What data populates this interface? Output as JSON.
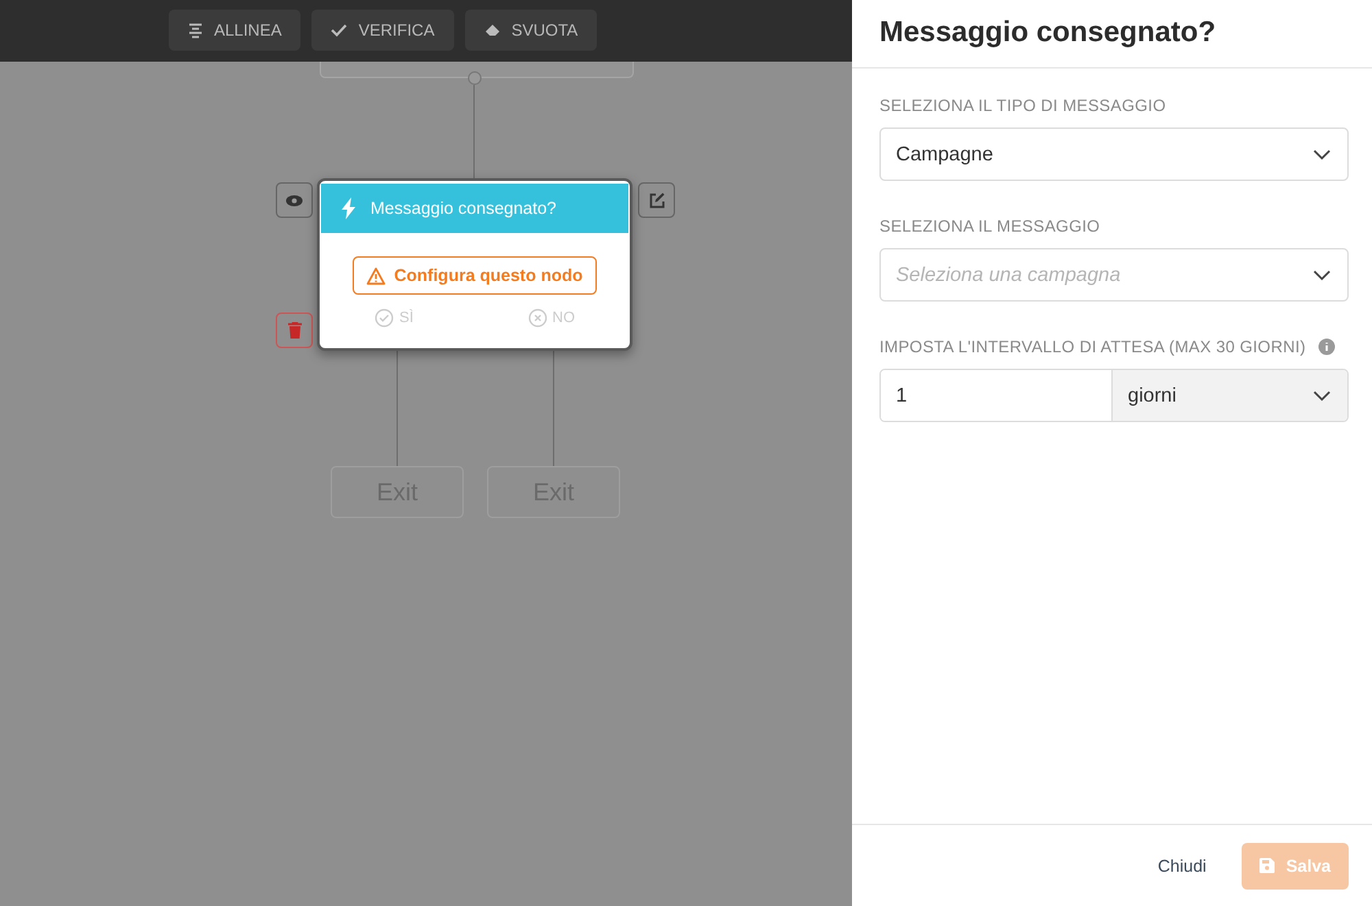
{
  "toolbar": [
    {
      "kind": "align",
      "label": "ALLINEA"
    },
    {
      "kind": "check",
      "label": "VERIFICA"
    },
    {
      "kind": "eraser",
      "label": "SVUOTA"
    }
  ],
  "node": {
    "title": "Messaggio consegnato?",
    "configure": "Configura questo nodo",
    "branches": [
      {
        "kind": "yes",
        "label": "SÌ"
      },
      {
        "kind": "no",
        "label": "NO"
      }
    ]
  },
  "exits": [
    "Exit",
    "Exit"
  ],
  "panel": {
    "title": "Messaggio consegnato?",
    "fields": [
      {
        "kind": "select",
        "label": "SELEZIONA IL TIPO DI MESSAGGIO",
        "value": "Campagne"
      },
      {
        "kind": "select",
        "label": "SELEZIONA IL MESSAGGIO",
        "placeholder": "Seleziona una campagna"
      },
      {
        "kind": "interval",
        "label": "IMPOSTA L'INTERVALLO DI ATTESA (MAX 30 GIORNI)",
        "value": "1",
        "unit": "giorni"
      }
    ],
    "footer": [
      {
        "kind": "close",
        "label": "Chiudi",
        "disabled": false
      },
      {
        "kind": "save",
        "label": "Salva",
        "disabled": true
      }
    ]
  }
}
